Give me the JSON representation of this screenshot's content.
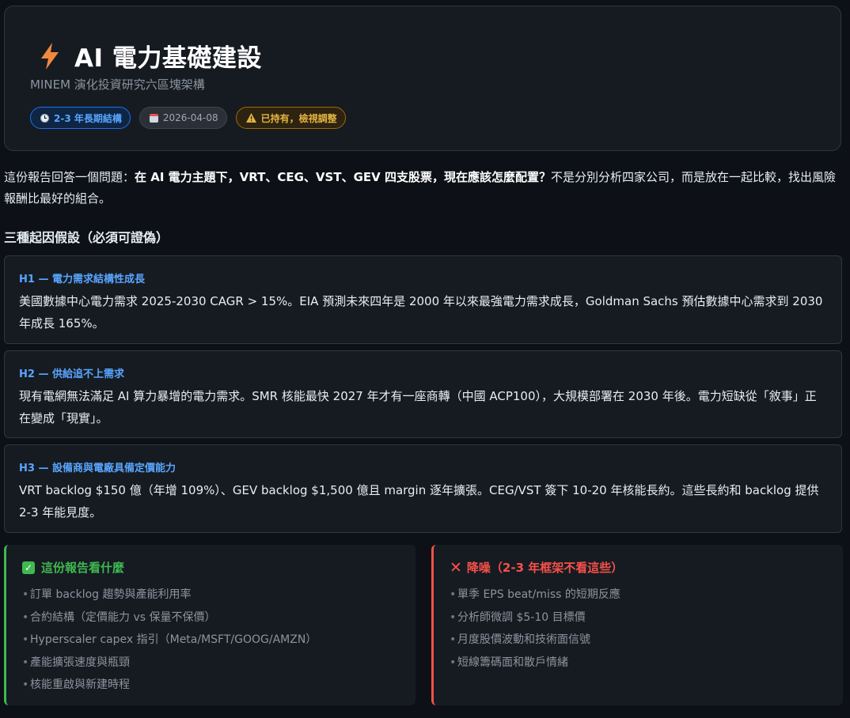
{
  "header": {
    "title": "AI 電力基礎建設",
    "subtitle": "MINEM 演化投資研究六區塊架構",
    "badges": {
      "horizon": "2-3 年長期結構",
      "date": "2026-04-08",
      "status": "已持有，檢視調整"
    }
  },
  "intro": {
    "lead": "這份報告回答一個問題：",
    "question": "在 AI 電力主題下，VRT、CEG、VST、GEV 四支股票，現在應該怎麼配置？",
    "tail": "不是分別分析四家公司，而是放在一起比較，找出風險報酬比最好的組合。"
  },
  "hypotheses_section": {
    "heading": "三種起因假設（必須可證偽）",
    "items": [
      {
        "label": "H1 — 電力需求結構性成長",
        "body": "美國數據中心電力需求 2025-2030 CAGR > 15%。EIA 預測未來四年是 2000 年以來最強電力需求成長，Goldman Sachs 預估數據中心需求到 2030 年成長 165%。"
      },
      {
        "label": "H2 — 供給追不上需求",
        "body": "現有電網無法滿足 AI 算力暴增的電力需求。SMR 核能最快 2027 年才有一座商轉（中國 ACP100），大規模部署在 2030 年後。電力短缺從「敘事」正在變成「現實」。"
      },
      {
        "label": "H3 — 設備商與電廠具備定價能力",
        "body": "VRT backlog $150 億（年增 109%）、GEV backlog $1,500 億且 margin 逐年擴張。CEG/VST 簽下 10-20 年核能長約。這些長約和 backlog 提供 2-3 年能見度。"
      }
    ]
  },
  "watch_box": {
    "title": "這份報告看什麼",
    "items": [
      "訂單 backlog 趨勢與產能利用率",
      "合約結構（定價能力 vs 保量不保價）",
      "Hyperscaler capex 指引（Meta/MSFT/GOOG/AMZN）",
      "產能擴張速度與瓶頸",
      "核能重啟與新建時程"
    ]
  },
  "noise_box": {
    "title": "降噪（2-3 年框架不看這些）",
    "items": [
      "單季 EPS beat/miss 的短期反應",
      "分析師微調 $5-10 目標價",
      "月度股價波動和技術面信號",
      "短線籌碼面和散戶情緒"
    ]
  },
  "icons": {
    "title": "lightning-bolt-icon",
    "horizon": "clock-icon",
    "date": "calendar-icon",
    "status": "warning-icon",
    "watch": "check-box-icon",
    "noise": "cross-icon"
  },
  "colors": {
    "background": "#0d1117",
    "card": "#161b22",
    "accent_blue": "#58a6ff",
    "accent_green": "#3fb950",
    "accent_red": "#f85149",
    "accent_amber": "#e3b341",
    "bolt_orange": "#f0883e"
  }
}
